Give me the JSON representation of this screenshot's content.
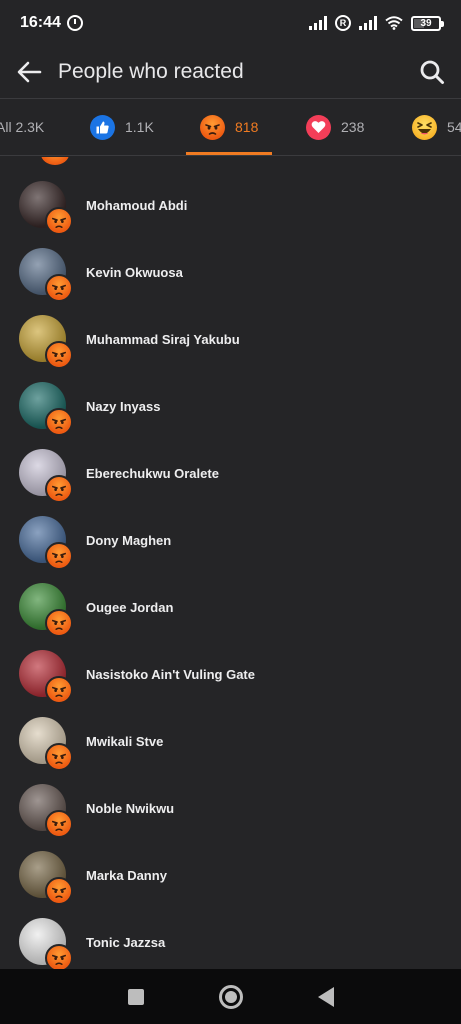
{
  "status_bar": {
    "time": "16:44",
    "registered_symbol": "R",
    "battery": "39",
    "battery_level": 0.39
  },
  "header": {
    "title": "People who reacted",
    "back_icon": "arrow-left-icon",
    "search_icon": "search-icon"
  },
  "tabs": [
    {
      "id": "all",
      "label": "All 2.3K",
      "emoji": null
    },
    {
      "id": "like",
      "count": "1.1K",
      "emoji": "like-icon",
      "color": "#1b74e4"
    },
    {
      "id": "angry",
      "count": "818",
      "emoji": "angry-icon",
      "color": "#f07b22",
      "active": true
    },
    {
      "id": "love",
      "count": "238",
      "emoji": "heart-icon",
      "color": "#f33e58"
    },
    {
      "id": "haha",
      "count": "54",
      "emoji": "haha-icon",
      "color": "#f7b125"
    }
  ],
  "reaction": "angry",
  "people": [
    {
      "name": "Mohamoud Abdi",
      "avatar_color": "#3a2a2a"
    },
    {
      "name": "Kevin Okwuosa",
      "avatar_color": "#5a6f8a"
    },
    {
      "name": "Muhammad Siraj Yakubu",
      "avatar_color": "#c9a63a"
    },
    {
      "name": "Nazy Inyass",
      "avatar_color": "#1f6e6a"
    },
    {
      "name": "Eberechukwu Oralete",
      "avatar_color": "#c9c4d6"
    },
    {
      "name": "Dony Maghen",
      "avatar_color": "#4c6f9e"
    },
    {
      "name": "Ougee Jordan",
      "avatar_color": "#3e8e3a"
    },
    {
      "name": "Nasistoko Ain't Vuling Gate",
      "avatar_color": "#b8303a"
    },
    {
      "name": "Mwikali Stve",
      "avatar_color": "#d8cbb4"
    },
    {
      "name": "Noble Nwikwu",
      "avatar_color": "#6a5c57"
    },
    {
      "name": "Marka Danny",
      "avatar_color": "#7a6a4a"
    },
    {
      "name": "Tonic Jazzsa",
      "avatar_color": "#e9e9e9"
    }
  ],
  "nav": {
    "recents_icon": "square-icon",
    "home_icon": "circle-home-icon",
    "back_icon": "triangle-back-icon"
  }
}
